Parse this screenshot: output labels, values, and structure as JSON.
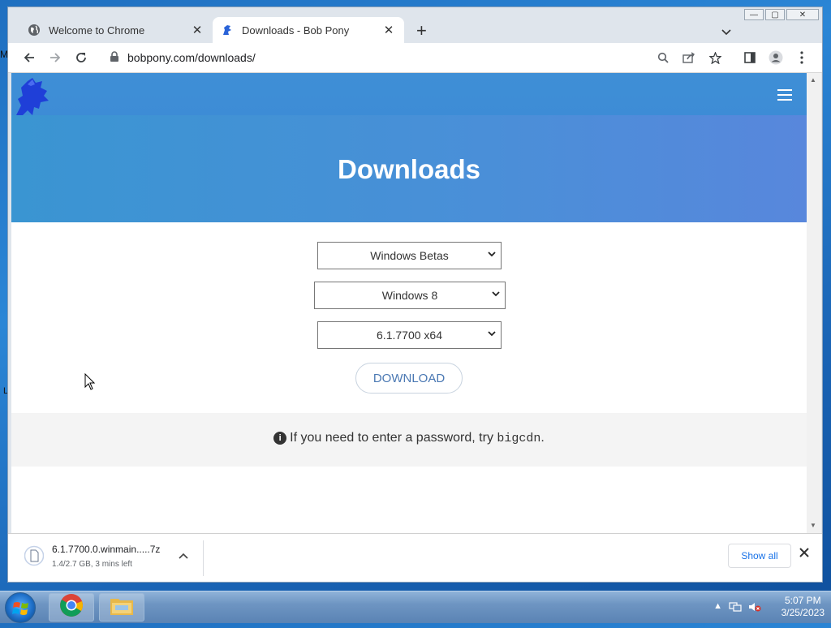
{
  "browser": {
    "tabs": [
      {
        "label": "Welcome to Chrome",
        "icon": "globe-icon",
        "active": false
      },
      {
        "label": "Downloads - Bob Pony",
        "icon": "bob-pony-favicon",
        "active": true
      }
    ],
    "url": "bobpony.com/downloads/",
    "window_buttons": {
      "minimize": "—",
      "maximize": "▢",
      "close": "✕"
    }
  },
  "page": {
    "title": "Downloads",
    "selects": [
      {
        "selected": "Windows Betas"
      },
      {
        "selected": "Windows 8"
      },
      {
        "selected": "6.1.7700 x64"
      }
    ],
    "download_button": "DOWNLOAD",
    "info": {
      "prefix": "If you need to enter a password, try ",
      "code": "bigcdn",
      "suffix": "."
    },
    "colors": {
      "hero": "#4a8ad6",
      "link": "#4a78b3"
    }
  },
  "download_shelf": {
    "filename": "6.1.7700.0.winmain.....7z",
    "status": "1.4/2.7 GB, 3 mins left",
    "show_all": "Show all"
  },
  "taskbar": {
    "time": "5:07 PM",
    "date": "3/25/2023",
    "pinned": [
      "chrome-icon",
      "folder-icon"
    ]
  },
  "desktop": {
    "edge_letter_top": "M",
    "edge_letter_mid": "L"
  }
}
